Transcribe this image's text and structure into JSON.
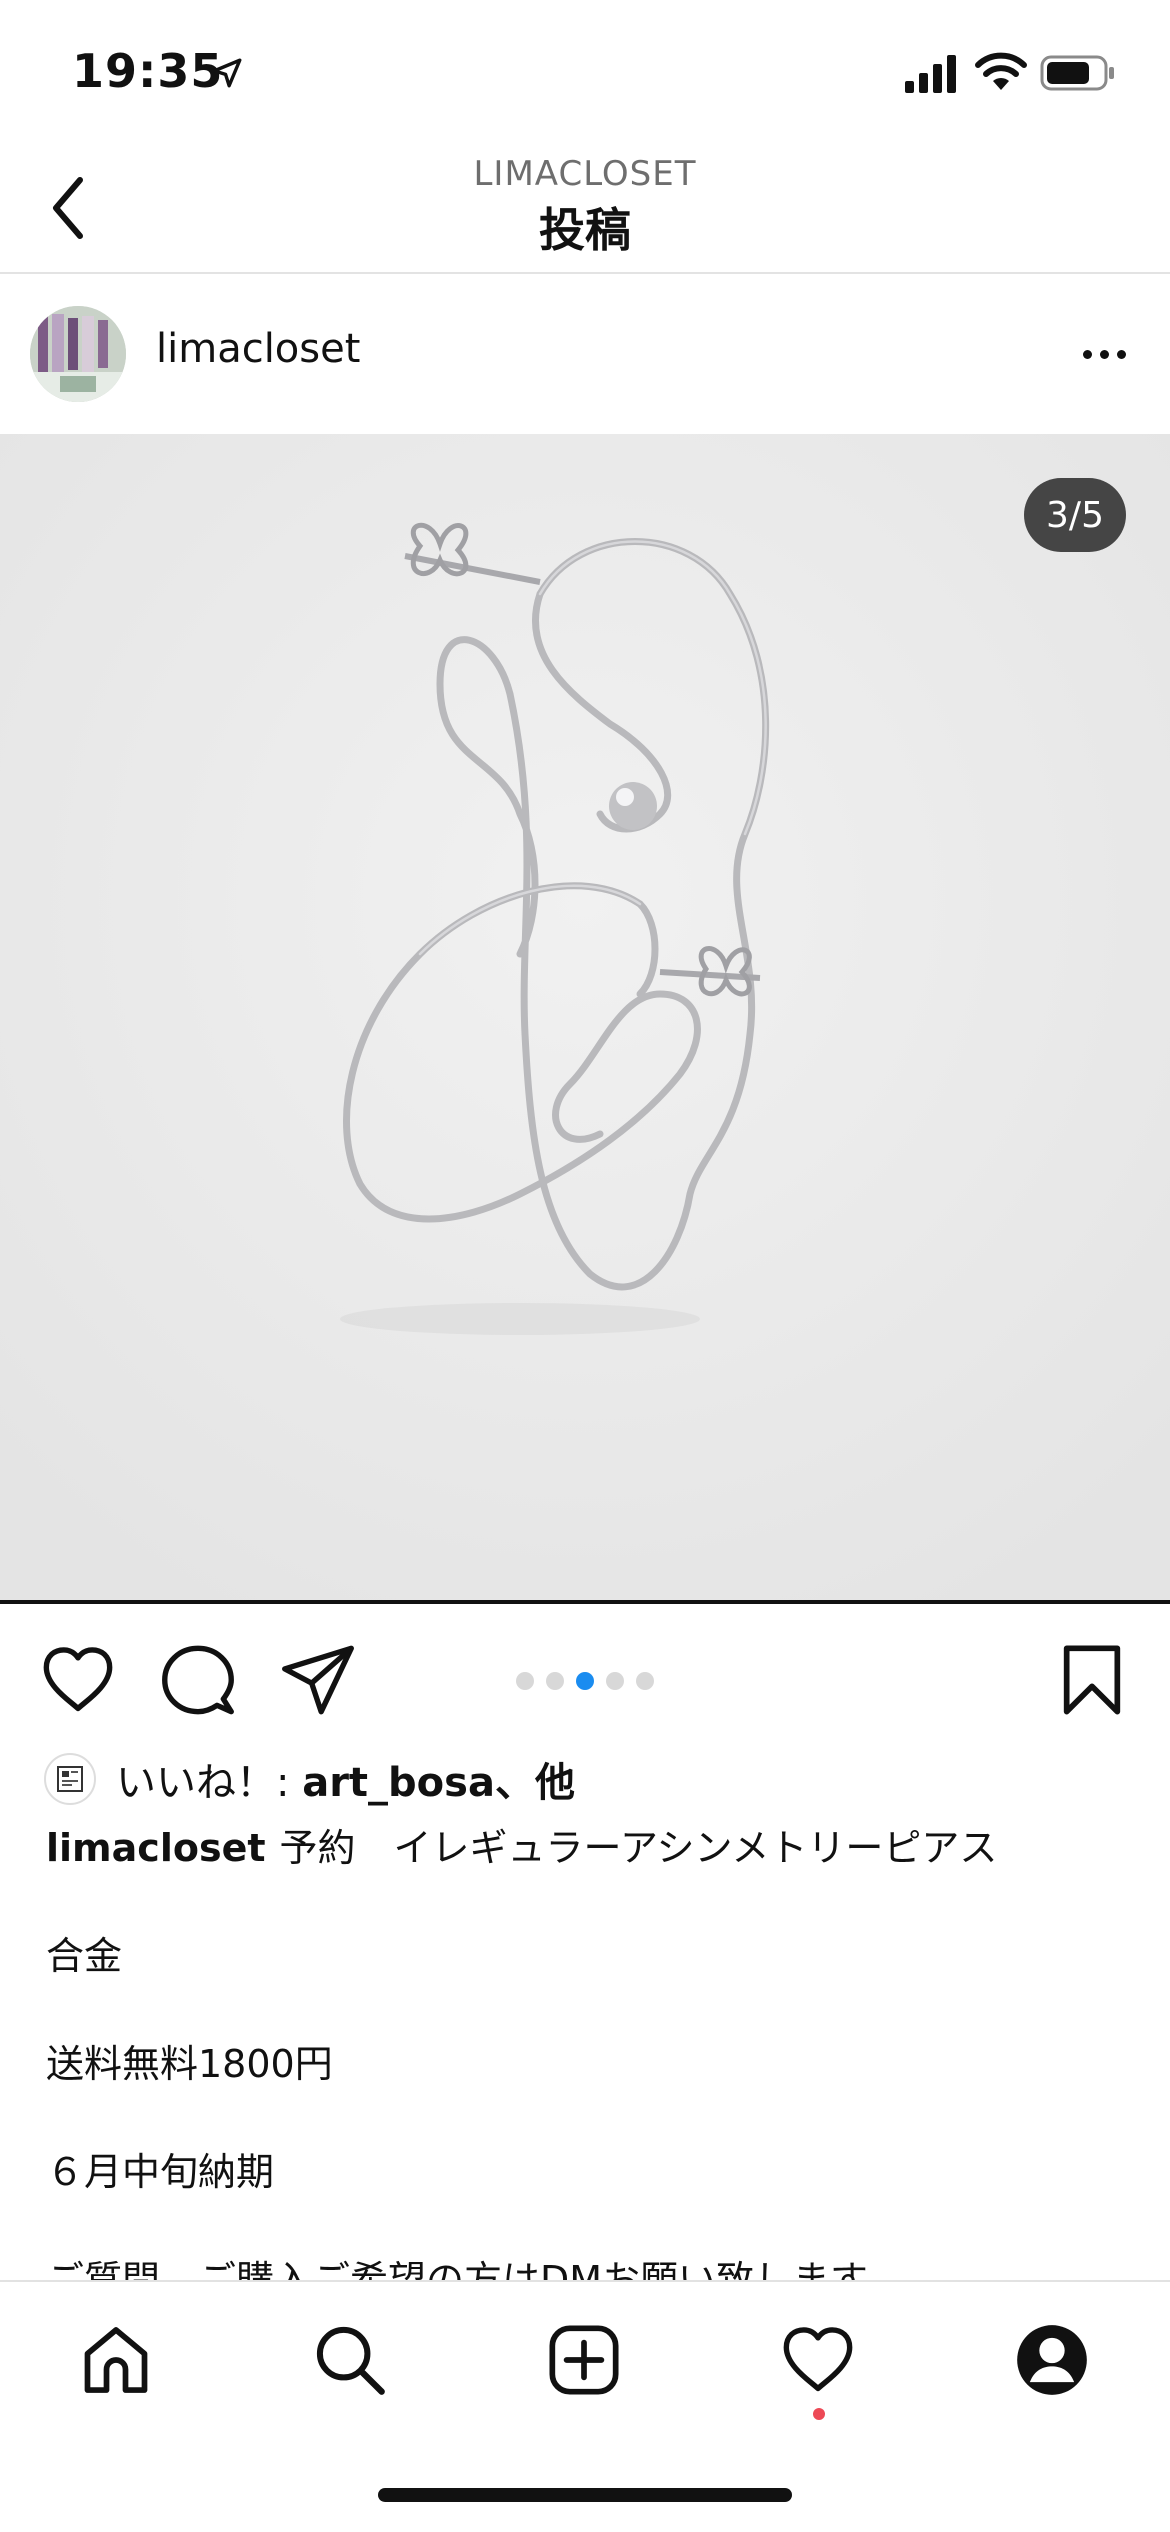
{
  "status_bar": {
    "time": "19:35"
  },
  "header": {
    "subtitle": "LIMACLOSET",
    "title": "投稿"
  },
  "post": {
    "username": "limacloset",
    "image_counter": "3/5",
    "carousel": {
      "total": 5,
      "active_index": 2
    },
    "likes": {
      "prefix": "いいね！: ",
      "user": "art_bosa",
      "suffix": "、他"
    },
    "caption": {
      "user": "limacloset",
      "line1": "予約　イレギュラーアシンメトリーピアス",
      "line2": "合金",
      "line3": "送料無料1800円",
      "line4": "６月中旬納期",
      "line5": "ご質問、ご購入ご希望の方はDMお願い致します"
    }
  },
  "colors": {
    "accent_dot": "#1a8cf0",
    "notification_dot": "#ed4956"
  },
  "icons": {
    "back": "chevron-left-icon",
    "more": "more-horizontal-icon",
    "like": "heart-outline-icon",
    "comment": "comment-bubble-icon",
    "share": "paper-plane-icon",
    "save": "bookmark-icon",
    "nav": [
      "home-icon",
      "search-icon",
      "plus-square-icon",
      "heart-icon",
      "profile-icon"
    ]
  }
}
